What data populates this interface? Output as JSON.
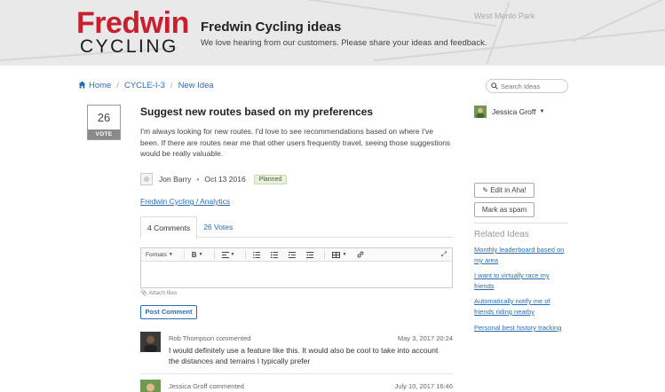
{
  "banner": {
    "logo_line1": "Fredwin",
    "logo_line2": "CYCLING",
    "title": "Fredwin Cycling ideas",
    "subtitle": "We love hearing from our customers. Please share your ideas and feedback.",
    "map_labels": [
      "West Menlo Park"
    ]
  },
  "breadcrumb": {
    "home": "Home",
    "item2": "CYCLE-I-3",
    "item3": "New Idea"
  },
  "search": {
    "placeholder": "Search Ideas"
  },
  "idea": {
    "votes": "26",
    "vote_label": "VOTE",
    "title": "Suggest new routes based on my preferences",
    "description": "I'm always looking for new routes. I'd love to see recommendations based on where I've been. If there are routes near me that other users frequently travel, seeing those suggestions would be really valuable.",
    "author": "Jon Barry",
    "date": "Oct 13 2016",
    "status": "Planned",
    "category": "Fredwin Cycling / Analytics"
  },
  "tabs": {
    "comments": "4 Comments",
    "votes": "26 Votes"
  },
  "editor": {
    "formats": "Formats",
    "attach": "Attach files",
    "post": "Post Comment"
  },
  "comments": [
    {
      "who": "Rob Thompson commented",
      "when": "May 3, 2017 20:24",
      "body": "I would definitely use a feature like this. It would also be cool to take into account the distances and terrains I typically prefer"
    },
    {
      "who": "Jessica Groff commented",
      "when": "July 10, 2017 16:46",
      "body": ""
    }
  ],
  "sidebar": {
    "user": "Jessica Groff",
    "edit_button": "Edit in Aha!",
    "spam_button": "Mark as spam",
    "related_title": "Related Ideas",
    "related": [
      "Monthly leaderboard based on my area",
      "I want to virtually race my friends",
      "Automatically notify me of friends riding nearby",
      "Personal best history tracking"
    ]
  },
  "colors": {
    "brand_red": "#c8202f",
    "link_blue": "#2a6eb8",
    "status_green": "#e9f1d9"
  }
}
